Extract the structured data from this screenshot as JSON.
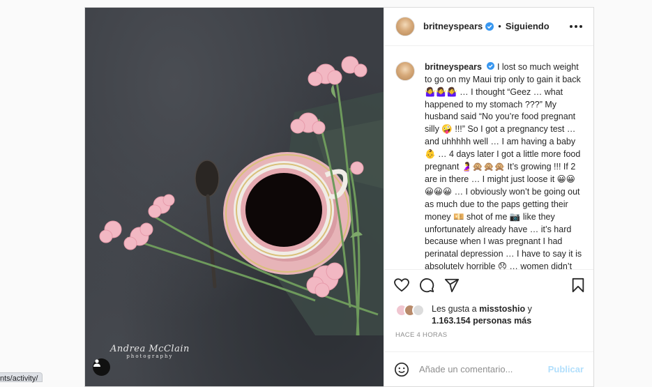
{
  "post": {
    "username": "britneyspears",
    "follow_status": "Siguiendo",
    "separator": "•",
    "caption": "I lost so much weight to go on my Maui trip only to gain it back 🤷‍♀️🤷‍♀️🤷‍♀️ … I thought “Geez … what happened to my stomach ???” My husband said “No you’re food pregnant silly 🤪 !!!” So I got a pregnancy test … and uhhhhh well … I am having a baby 👶 … 4 days later I got a little more food pregnant 🤰🙊🙊🙊 It’s growing !!! If 2 are in there … I might just loose it 😀😀😀😀😀 … I obviously won’t be going out as much due to the paps getting their money 💴 shot of me 📷 like they unfortunately already have … it’s hard because when I was pregnant I had perinatal depression … I have to say it is absolutely horrible 😞 … women didn’t talk about it back then … some people considered it dangerous if",
    "likes_prefix": "Les gusta a",
    "likes_user": "misstoshio",
    "likes_and": "y",
    "likes_count": "1.163.154 personas más",
    "timestamp": "HACE 4 HORAS",
    "comment_placeholder": "Añade un comentario...",
    "publish_label": "Publicar"
  },
  "image": {
    "watermark_name": "Andrea McClain",
    "watermark_sub": "photography"
  },
  "browser": {
    "status_url": "nts/activity/"
  },
  "icons": {
    "verified": "verified-badge-icon",
    "more": "more-options-icon",
    "like": "heart-icon",
    "comment": "comment-bubble-icon",
    "share": "paper-plane-icon",
    "save": "bookmark-icon",
    "emoji": "emoji-smile-icon",
    "tag": "user-tag-icon"
  },
  "colors": {
    "verified_blue": "#3897f0",
    "publish_disabled": "#b2dffc",
    "muted_text": "#8e8e8e"
  }
}
